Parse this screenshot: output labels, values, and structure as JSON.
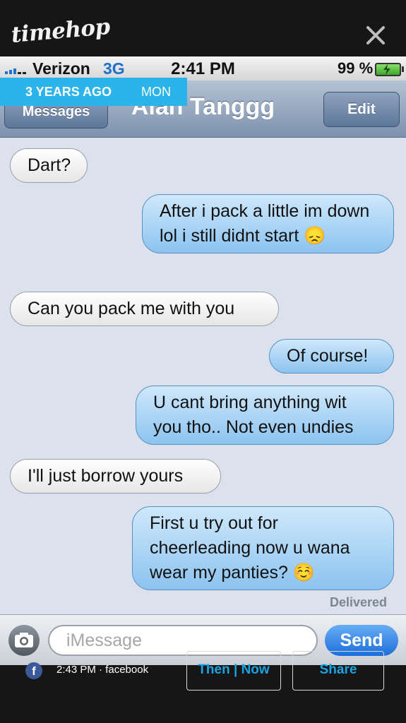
{
  "timehop": {
    "logo": "timehop",
    "badge_ago": "3 YEARS AGO",
    "badge_day": "MON",
    "post_time": "2:43 PM · facebook",
    "then_now_label": "Then | Now",
    "share_label": "Share",
    "facebook_icon_text": "f"
  },
  "statusbar": {
    "carrier": "Verizon",
    "network": "3G",
    "time": "2:41 PM",
    "battery": "99 %"
  },
  "navbar": {
    "back_label": "Messages",
    "title": "Alan Tanggg",
    "edit_label": "Edit"
  },
  "messages": [
    {
      "from": "them",
      "text": "Dart?"
    },
    {
      "from": "me",
      "text": "After i pack a little im down lol i still didnt start 😞"
    },
    {
      "from": "them",
      "text": "Can you pack me with you"
    },
    {
      "from": "me",
      "text": "Of course!"
    },
    {
      "from": "me",
      "text": "U cant bring anything wit you tho.. Not even undies"
    },
    {
      "from": "them",
      "text": "I'll just borrow yours"
    },
    {
      "from": "me",
      "text": "First u try out for cheerleading now u wana wear my panties? ☺️"
    }
  ],
  "delivered_label": "Delivered",
  "composer": {
    "placeholder": "iMessage",
    "send_label": "Send"
  },
  "colors": {
    "timehop_blue": "#2ab4ea",
    "sent_bubble": "#8cc3ef",
    "received_bubble": "#ffffff",
    "facebook_blue": "#3b5998"
  }
}
